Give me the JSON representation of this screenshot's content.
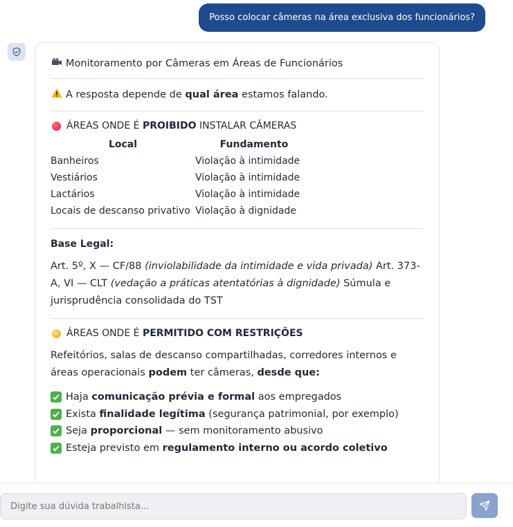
{
  "user_message": "Posso colocar câmeras na área exclusiva dos funcionários?",
  "bot": {
    "title": "Monitoramento por Câmeras em Áreas de Funcionários",
    "warning_pre": "A resposta depende de ",
    "warning_bold": "qual área",
    "warning_post": " estamos falando.",
    "prohibited": {
      "title_pre": "ÁREAS ONDE É ",
      "title_bold": "PROIBIDO",
      "title_post": " INSTALAR CÂMERAS",
      "headers": [
        "Local",
        "Fundamento"
      ],
      "rows": [
        [
          "Banheiros",
          "Violação à intimidade"
        ],
        [
          "Vestiários",
          "Violação à intimidade"
        ],
        [
          "Lactários",
          "Violação à intimidade"
        ],
        [
          "Locais de descanso privativo",
          "Violação à dignidade"
        ]
      ]
    },
    "legal": {
      "title": "Base Legal:",
      "p1": "Art. 5º, X — CF/88 ",
      "p1_italic": "(inviolabilidade da intimidade e vida privada)",
      "p2": " Art. 373-A, VI — CLT ",
      "p2_italic": "(vedação a práticas atentatórias à dignidade)",
      "p3": " Súmula e jurisprudência consolidada do TST"
    },
    "allowed": {
      "title_pre": "ÁREAS ONDE É ",
      "title_bold": "PERMITIDO COM RESTRIÇÕES",
      "intro_1": "Refeitórios, salas de descanso compartilhadas, corredores internos e áreas operacionais ",
      "intro_bold1": "podem",
      "intro_2": " ter câmeras, ",
      "intro_bold2": "desde que:",
      "items": [
        {
          "pre": "Haja ",
          "bold": "comunicação prévia e formal",
          "post": " aos empregados"
        },
        {
          "pre": "Exista ",
          "bold": "finalidade legítima",
          "post": " (segurança patrimonial, por exemplo)"
        },
        {
          "pre": "Seja ",
          "bold": "proporcional",
          "post": " — sem monitoramento abusivo"
        },
        {
          "pre": "Esteja previsto em ",
          "bold": "regulamento interno ou acordo coletivo",
          "post": ""
        }
      ]
    }
  },
  "input": {
    "placeholder": "Digite sua dúvida trabalhista..."
  },
  "icons": {
    "avatar": "shield-check-icon",
    "title": "video-camera-icon",
    "warning": "warning-icon",
    "send": "send-icon"
  }
}
